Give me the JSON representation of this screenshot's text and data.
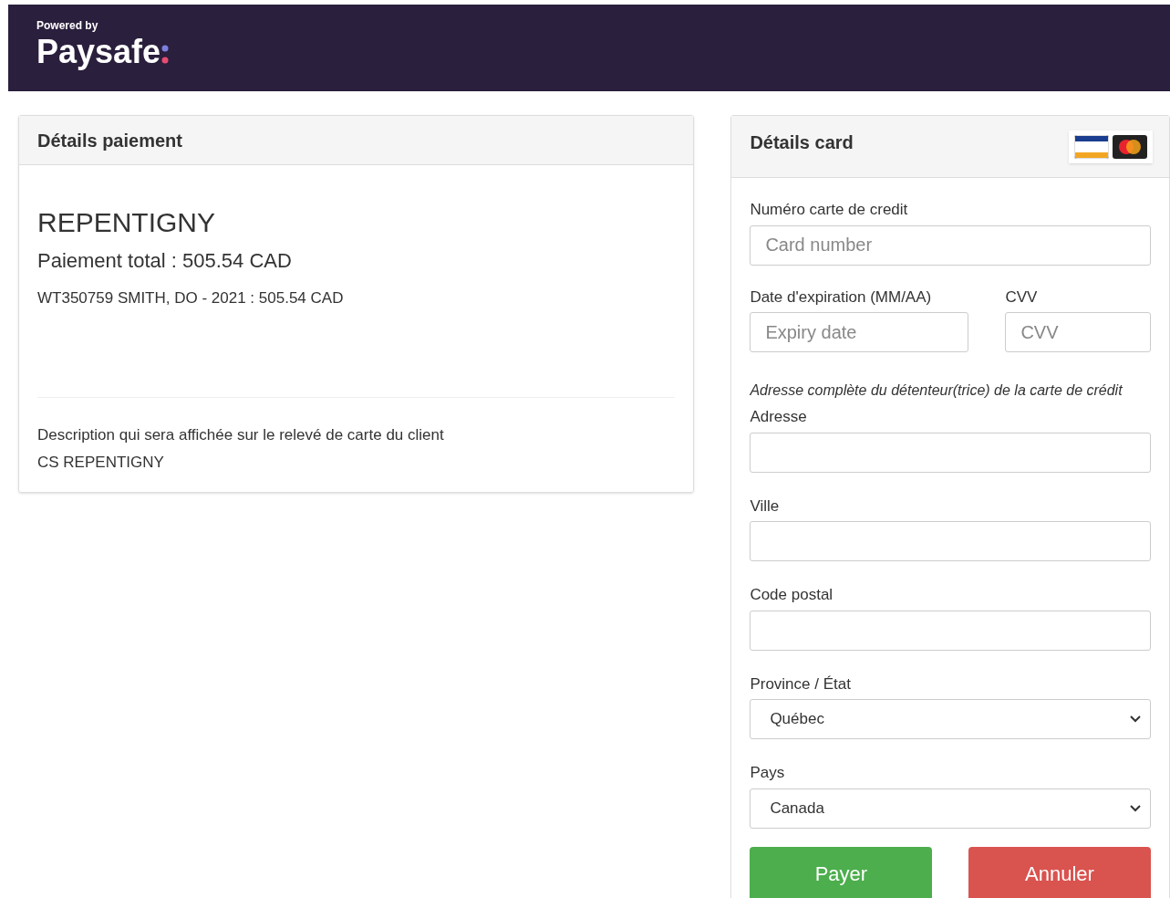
{
  "header": {
    "powered_by": "Powered by",
    "brand": "Paysafe"
  },
  "payment_details": {
    "title": "Détails paiement",
    "merchant": "REPENTIGNY",
    "total": "Paiement total : 505.54 CAD",
    "line_item": "WT350759 SMITH, DO - 2021 : 505.54 CAD",
    "description_label": "Description qui sera affichée sur le relevé de carte du client",
    "description_value": "CS REPENTIGNY"
  },
  "card_details": {
    "title": "Détails card",
    "card_number": {
      "label": "Numéro carte de credit",
      "placeholder": "Card number"
    },
    "expiry": {
      "label": "Date d'expiration (MM/AA)",
      "placeholder": "Expiry date"
    },
    "cvv": {
      "label": "CVV",
      "placeholder": "CVV"
    },
    "address_note": "Adresse complète du détenteur(trice) de la carte de crédit",
    "address_fields": [
      {
        "kind": "text",
        "label": "Adresse"
      },
      {
        "kind": "text",
        "label": "Ville"
      },
      {
        "kind": "text",
        "label": "Code postal"
      },
      {
        "kind": "select",
        "label": "Province / État",
        "value": "Québec"
      },
      {
        "kind": "select",
        "label": "Pays",
        "value": "Canada"
      }
    ],
    "buttons": [
      {
        "kind": "primary",
        "label": "Payer"
      },
      {
        "kind": "danger",
        "label": "Annuler"
      }
    ]
  }
}
